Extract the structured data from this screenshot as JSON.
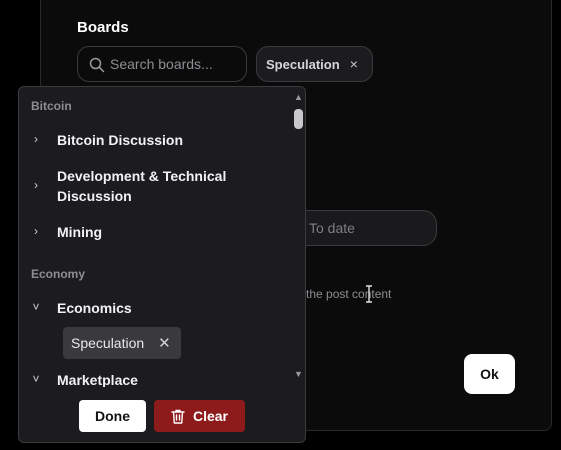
{
  "boards": {
    "label": "Boards",
    "search_placeholder": "Search boards...",
    "selected_chip": {
      "label": "Speculation",
      "remove": "×"
    }
  },
  "date": {
    "to_placeholder": "To date"
  },
  "hint_text": "the post content",
  "ok_label": "Ok",
  "dropdown": {
    "groups": [
      {
        "label": "Bitcoin",
        "items": [
          {
            "label": "Bitcoin Discussion",
            "chevron": "›"
          },
          {
            "label": "Development & Technical",
            "label2": "Discussion",
            "chevron": "›"
          },
          {
            "label": "Mining",
            "chevron": "›"
          }
        ]
      },
      {
        "label": "Economy",
        "items": [
          {
            "label": "Economics",
            "chevron": "˅",
            "children": [
              {
                "label": "Speculation",
                "remove": "✕"
              }
            ]
          },
          {
            "label": "Marketplace",
            "chevron": "˅"
          }
        ]
      }
    ],
    "scroll_up": "▲",
    "scroll_down": "▼",
    "done_label": "Done",
    "clear_label": "Clear"
  },
  "icons": [
    "search-icon",
    "close-icon",
    "chevron-right-icon",
    "chevron-down-icon",
    "trash-icon",
    "text-cursor-icon"
  ],
  "colors": {
    "clear_button": "#8e1b1b",
    "background": "#0b0b0c",
    "dropdown": "#1c1c1e"
  }
}
